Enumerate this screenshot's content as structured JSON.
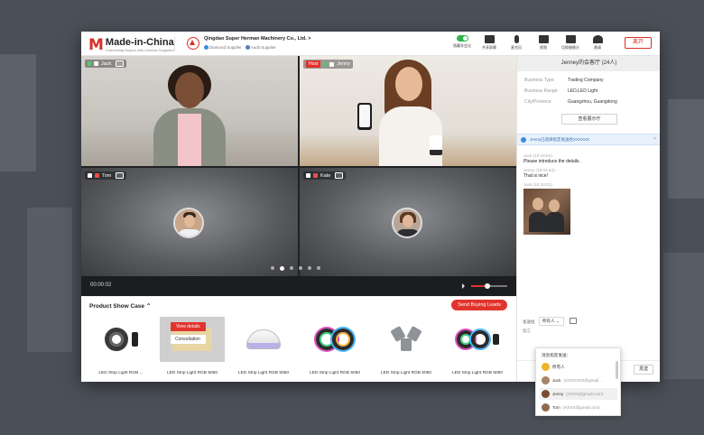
{
  "header": {
    "brand": "Made-in-China",
    "brand_sub": "Connecting Buyers with Chinese Suppliers",
    "company_name": "Qingdao Super Herman Machinery Co., Ltd.",
    "company_chevron": ">",
    "badges": [
      "Diamond Supplier",
      "Audit Supplier"
    ],
    "tools": [
      {
        "icon": "toggle-icon",
        "label": "隐藏非会议",
        "kind": "toggle"
      },
      {
        "icon": "screen-share-icon",
        "label": "共享屏幕",
        "kind": "box"
      },
      {
        "icon": "mic-icon",
        "label": "麦克风",
        "kind": "mic"
      },
      {
        "icon": "camera-icon",
        "label": "视频",
        "kind": "box"
      },
      {
        "icon": "snapshot-icon",
        "label": "切换摄像头",
        "kind": "box"
      },
      {
        "icon": "invite-icon",
        "label": "邀请",
        "kind": "box"
      }
    ],
    "leave_label": "离开"
  },
  "video": {
    "tiles": [
      {
        "name": "Jack",
        "host": false,
        "host_label": ""
      },
      {
        "name": "Jenny",
        "host": true,
        "host_label": "Host"
      },
      {
        "name": "Tom",
        "host": false,
        "host_label": ""
      },
      {
        "name": "Kate",
        "host": false,
        "host_label": ""
      }
    ],
    "timer": "00:00:02",
    "page_count": 6,
    "active_page": 1,
    "volume": 0.45
  },
  "products": {
    "title": "Product Show Case",
    "send_leads_label": "Send Buying Leads",
    "view_details_label": "View details",
    "consultation_label": "Consultation",
    "items": [
      {
        "label": "LED Strip Light RGB ...",
        "icon": "led-strip-reel-icon"
      },
      {
        "label": "LED Strip Light RGB 5050",
        "icon": "led-strip-box-icon"
      },
      {
        "label": "LED Strip Light RGB 5050",
        "icon": "uv-lamp-icon"
      },
      {
        "label": "LED Strip Light RGB 5050",
        "icon": "rgb-strip-icon"
      },
      {
        "label": "LED Strip Light RGB 5050",
        "icon": "deformable-lamp-icon"
      },
      {
        "label": "LED Strip Light RGB 5050",
        "icon": "led-kit-icon"
      }
    ]
  },
  "panel": {
    "room_title": "Jenney的会客厅 (24人)",
    "info": [
      {
        "k": "Business Type:",
        "v": "Trading Company"
      },
      {
        "k": "Business Range:",
        "v": "LED,LED Light"
      },
      {
        "k": "City/Province:",
        "v": "Guangzhou, Guangdong"
      }
    ],
    "view_hall_label": "查看展示厅",
    "notice": "Jenny已选择指定发送给XXXXXX",
    "notice_close": "×",
    "messages": [
      {
        "meta": "Jack (19:18:01):",
        "text": "Please introduce the details."
      },
      {
        "meta": "Jenny (19:01:54):",
        "text": "That is nice!"
      },
      {
        "meta": "Jack (18:18:01):",
        "text": ""
      }
    ],
    "send_to_label": "发送给",
    "send_to_value": "所有人",
    "reply_label": "留言",
    "send_label": "发送"
  },
  "dropdown": {
    "title": "消息指定发送：",
    "options": [
      {
        "name": "所有人",
        "email": "",
        "selected": false,
        "all": true
      },
      {
        "name": "Jack",
        "email": "(XXXXXXX@gmail...",
        "selected": false,
        "all": false
      },
      {
        "name": "Jenny",
        "email": "(XXXX@gmail.com)",
        "selected": true,
        "all": false
      },
      {
        "name": "Tom",
        "email": "(XXXX@gmail.com)",
        "selected": false,
        "all": false
      }
    ]
  }
}
